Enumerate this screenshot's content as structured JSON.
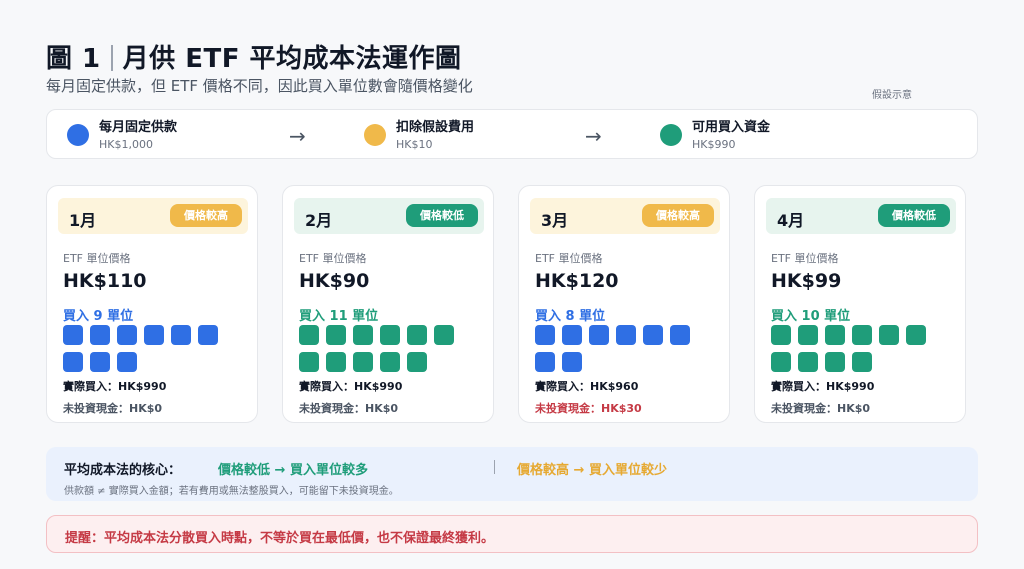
{
  "header": {
    "fig_label": "圖 1",
    "title": "月供 ETF 平均成本法運作圖",
    "subtitle": "每月固定供款，但 ETF 價格不同，因此買入單位數會隨價格變化",
    "note": "假設示意"
  },
  "flow": [
    {
      "label": "每月固定供款",
      "value": "HK$1,000",
      "color": "#2f6fe4"
    },
    {
      "label": "扣除假設費用",
      "value": "HK$10",
      "color": "#f0b94a"
    },
    {
      "label": "可用買入資金",
      "value": "HK$990",
      "color": "#1f9d7a"
    }
  ],
  "colors": {
    "blue": "#2f6fe4",
    "green": "#1f9d7a",
    "amber": "#f0b94a",
    "red": "#c53a45",
    "amber_bg": "#fdf4dc",
    "green_bg": "#e7f4ee"
  },
  "months": [
    {
      "month": "1月",
      "badge": "價格較高",
      "badge_kind": "high",
      "price_label": "ETF 單位價格",
      "price": "HK$110",
      "buy_text": "買入 9 單位",
      "units": 9,
      "actual": "實際買入：HK$990",
      "cash": "未投資現金：HK$0",
      "cash_highlight": false
    },
    {
      "month": "2月",
      "badge": "價格較低",
      "badge_kind": "low",
      "price_label": "ETF 單位價格",
      "price": "HK$90",
      "buy_text": "買入 11 單位",
      "units": 11,
      "actual": "實際買入：HK$990",
      "cash": "未投資現金：HK$0",
      "cash_highlight": false
    },
    {
      "month": "3月",
      "badge": "價格較高",
      "badge_kind": "high",
      "price_label": "ETF 單位價格",
      "price": "HK$120",
      "buy_text": "買入 8 單位",
      "units": 8,
      "actual": "實際買入：HK$960",
      "cash": "未投資現金：HK$30",
      "cash_highlight": true
    },
    {
      "month": "4月",
      "badge": "價格較低",
      "badge_kind": "low",
      "price_label": "ETF 單位價格",
      "price": "HK$99",
      "buy_text": "買入 10 單位",
      "units": 10,
      "actual": "實際買入：HK$990",
      "cash": "未投資現金：HK$0",
      "cash_highlight": false
    }
  ],
  "core": {
    "title": "平均成本法的核心：",
    "low_rule": "價格較低 → 買入單位較多",
    "high_rule": "價格較高 → 買入單位較少",
    "note": "供款額 ≠ 實際買入金額；若有費用或無法整股買入，可能留下未投資現金。"
  },
  "warning": "提醒：平均成本法分散買入時點，不等於買在最低價，也不保證最終獲利。"
}
